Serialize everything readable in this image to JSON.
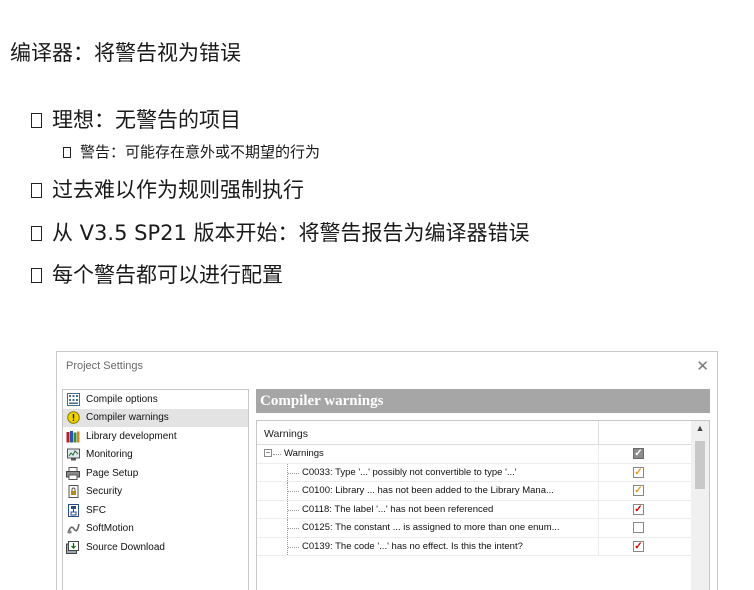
{
  "slide": {
    "title": "编译器：将警告视为错误",
    "bullets": [
      {
        "text": "理想：无警告的项目",
        "level": 1
      },
      {
        "text": "警告：可能存在意外或不期望的行为",
        "level": 2
      },
      {
        "text": "过去难以作为规则强制执行",
        "level": 1
      },
      {
        "text": "从 V3.5 SP21 版本开始：将警告报告为编译器错误",
        "level": 1
      },
      {
        "text": "每个警告都可以进行配置",
        "level": 1
      }
    ]
  },
  "dialog": {
    "title": "Project Settings",
    "close_icon": "close-icon",
    "sidebar": {
      "selected": "Compiler warnings",
      "items": [
        {
          "label": "Compile options",
          "icon": "compile-options-icon"
        },
        {
          "label": "Compiler warnings",
          "icon": "warning-icon"
        },
        {
          "label": "Library development",
          "icon": "library-icon"
        },
        {
          "label": "Monitoring",
          "icon": "monitoring-icon"
        },
        {
          "label": "Page Setup",
          "icon": "printer-icon"
        },
        {
          "label": "Security",
          "icon": "security-icon"
        },
        {
          "label": "SFC",
          "icon": "sfc-icon"
        },
        {
          "label": "SoftMotion",
          "icon": "softmotion-icon"
        },
        {
          "label": "Source Download",
          "icon": "download-icon"
        }
      ]
    },
    "main": {
      "header": "Compiler warnings",
      "grid": {
        "column_header": "Warnings",
        "group": {
          "label": "Warnings",
          "expander": "−",
          "state": "partial"
        },
        "rows": [
          {
            "label": "C0033: Type '...' possibly not convertible to type '...'",
            "state": "orange"
          },
          {
            "label": "C0100: Library ... has not been added to the Library Mana...",
            "state": "orange"
          },
          {
            "label": "C0118: The label '...' has not been referenced",
            "state": "red"
          },
          {
            "label": "C0125: The constant ... is assigned to more than one enum...",
            "state": "empty"
          },
          {
            "label": "C0139: The code '...' has no effect. Is this the intent?",
            "state": "red"
          }
        ]
      }
    }
  },
  "colors": {
    "header_bg": "#a6a6a6",
    "check_orange": "#e69a1a",
    "check_red": "#d40000",
    "selected_bg": "#e3e3e3"
  }
}
